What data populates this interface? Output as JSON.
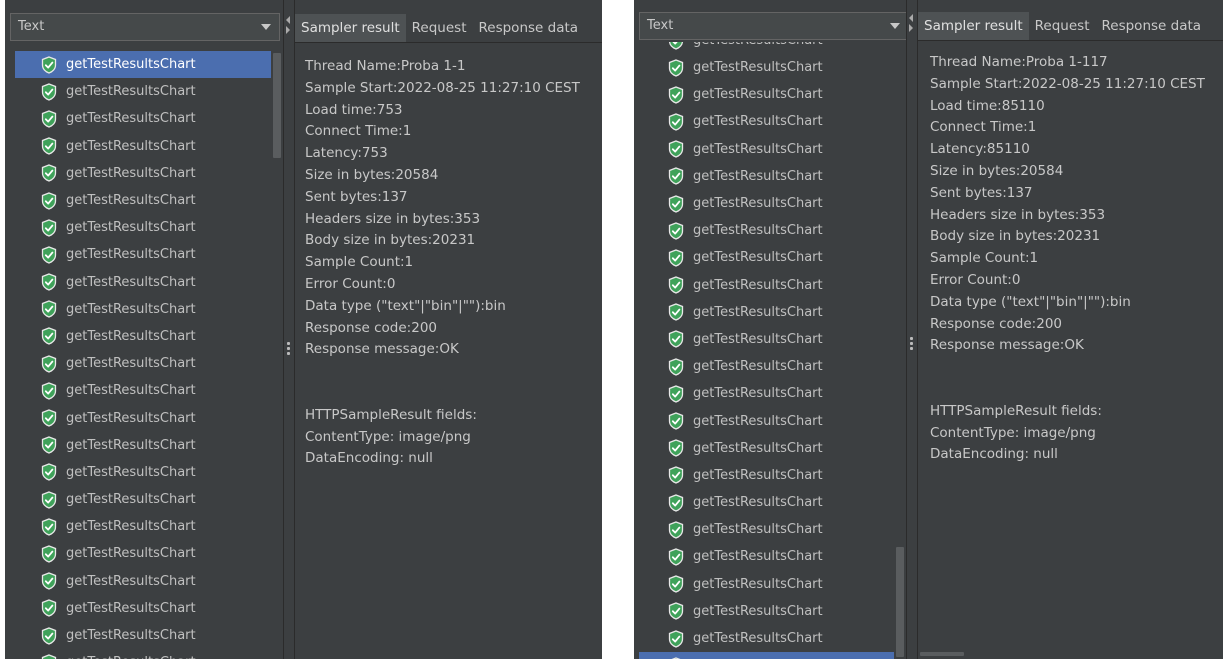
{
  "left": {
    "view_mode": "Text",
    "tree_items": [
      "getTestResultsChart",
      "getTestResultsChart",
      "getTestResultsChart",
      "getTestResultsChart",
      "getTestResultsChart",
      "getTestResultsChart",
      "getTestResultsChart",
      "getTestResultsChart",
      "getTestResultsChart",
      "getTestResultsChart",
      "getTestResultsChart",
      "getTestResultsChart",
      "getTestResultsChart",
      "getTestResultsChart",
      "getTestResultsChart",
      "getTestResultsChart",
      "getTestResultsChart",
      "getTestResultsChart",
      "getTestResultsChart",
      "getTestResultsChart",
      "getTestResultsChart",
      "getTestResultsChart",
      "getTestResultsChart"
    ],
    "selected_index": 0,
    "tabs": [
      "Sampler result",
      "Request",
      "Response data"
    ],
    "details": [
      "Thread Name:Proba 1-1",
      "Sample Start:2022-08-25 11:27:10 CEST",
      "Load time:753",
      "Connect Time:1",
      "Latency:753",
      "Size in bytes:20584",
      "Sent bytes:137",
      "Headers size in bytes:353",
      "Body size in bytes:20231",
      "Sample Count:1",
      "Error Count:0",
      "Data type (\"text\"|\"bin\"|\"\"):bin",
      "Response code:200",
      "Response message:OK",
      "",
      "",
      "HTTPSampleResult fields:",
      "ContentType: image/png",
      "DataEncoding: null"
    ]
  },
  "right": {
    "view_mode": "Text",
    "partial_item": "getTestResultsChart",
    "tree_items": [
      "getTestResultsChart",
      "getTestResultsChart",
      "getTestResultsChart",
      "getTestResultsChart",
      "getTestResultsChart",
      "getTestResultsChart",
      "getTestResultsChart",
      "getTestResultsChart",
      "getTestResultsChart",
      "getTestResultsChart",
      "getTestResultsChart",
      "getTestResultsChart",
      "getTestResultsChart",
      "getTestResultsChart",
      "getTestResultsChart",
      "getTestResultsChart",
      "getTestResultsChart",
      "getTestResultsChart",
      "getTestResultsChart",
      "getTestResultsChart",
      "getTestResultsChart",
      "getTestResultsChart",
      "getTestResultsChart"
    ],
    "selected_index": 22,
    "tabs": [
      "Sampler result",
      "Request",
      "Response data"
    ],
    "details": [
      "Thread Name:Proba 1-117",
      "Sample Start:2022-08-25 11:27:10 CEST",
      "Load time:85110",
      "Connect Time:1",
      "Latency:85110",
      "Size in bytes:20584",
      "Sent bytes:137",
      "Headers size in bytes:353",
      "Body size in bytes:20231",
      "Sample Count:1",
      "Error Count:0",
      "Data type (\"text\"|\"bin\"|\"\"):bin",
      "Response code:200",
      "Response message:OK",
      "",
      "",
      "HTTPSampleResult fields:",
      "ContentType: image/png",
      "DataEncoding: null"
    ]
  },
  "icons": {
    "row_icon": "green-shield-check-icon"
  },
  "colors": {
    "panel_bg": "#3c3f41",
    "selection": "#4b6eaf",
    "shield": "#3fa25a"
  }
}
